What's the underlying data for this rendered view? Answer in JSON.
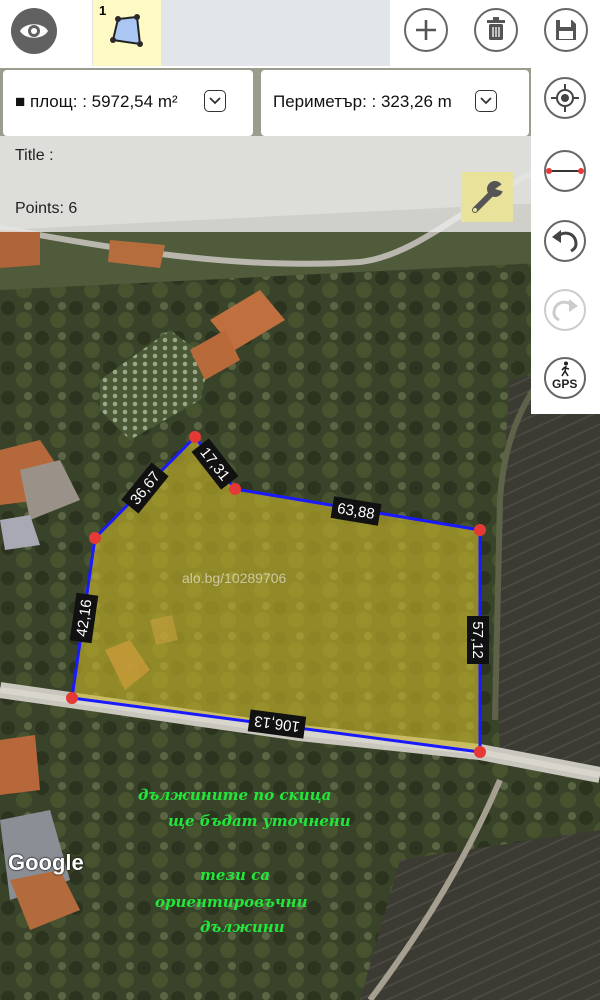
{
  "toolbar": {
    "layer_tab_number": "1",
    "icons": [
      "eye-icon",
      "polygon-icon",
      "plus-icon",
      "trash-icon",
      "save-icon"
    ]
  },
  "measurements": {
    "area_text": "■ площ: : 5972,54 m²",
    "perimeter_text": "Периметър: : 323,26 m"
  },
  "info_panel": {
    "title_label": "Title :",
    "points_label": "Points: 6"
  },
  "sidebar": {
    "icons": [
      "locate-icon",
      "line-measure-icon",
      "undo-icon",
      "redo-icon",
      "gps-walk-icon"
    ],
    "gps_label": "GPS"
  },
  "segment_labels": [
    "17,31",
    "63,88",
    "57,12",
    "106,13",
    "42,16",
    "36,67"
  ],
  "map": {
    "watermark": "alo.bg/10289706",
    "google_logo": "Google",
    "note_line1": "дължините по скица",
    "note_line2": "ще бъдат уточнени",
    "note_line3": "тези са",
    "note_line4": "ориентировъчни",
    "note_line5": "дължини"
  },
  "colors": {
    "polygon_fill": "#c9b62a",
    "polygon_edge": "#1a1aff",
    "vertex": "#e53935",
    "note_text": "#22e63a",
    "layer_tab": "#fff9c4"
  }
}
